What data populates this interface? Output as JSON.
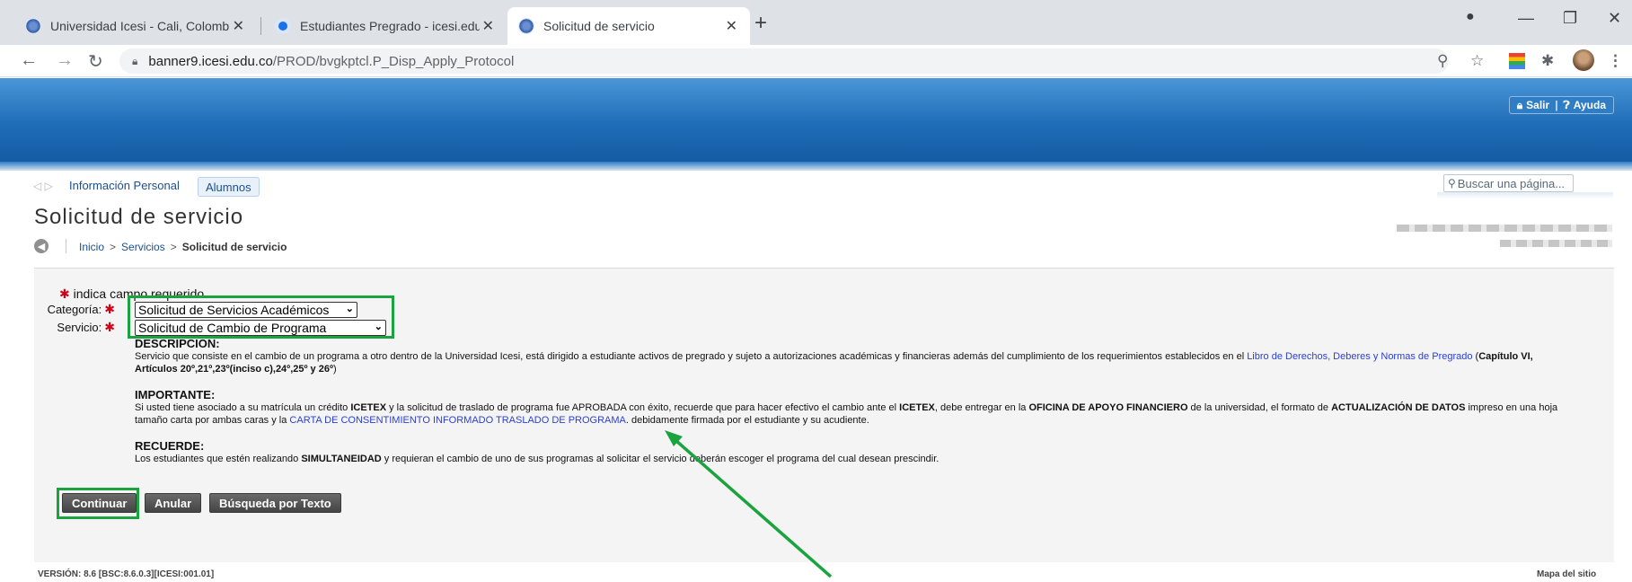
{
  "browser": {
    "tabs": [
      {
        "title": "Universidad Icesi - Cali, Colombia"
      },
      {
        "title": "Estudiantes Pregrado - icesi.edu.co"
      },
      {
        "title": "Solicitud de servicio"
      }
    ],
    "url_host": "banner9.icesi.edu.co",
    "url_path": "/PROD/bvgkptcl.P_Disp_Apply_Protocol"
  },
  "header": {
    "salir_label": "Salir",
    "ayuda_label": "Ayuda",
    "brand_color": "#1f6db8"
  },
  "nav": {
    "personal_label": "Información Personal",
    "alumnos_label": "Alumnos",
    "search_placeholder": "Buscar una página..."
  },
  "page": {
    "title": "Solicitud de servicio",
    "breadcrumb": {
      "inicio": "Inicio",
      "servicios": "Servicios",
      "current": "Solicitud de servicio"
    }
  },
  "form": {
    "required_note": "indica campo requerido",
    "categoria_label": "Categoría:",
    "categoria_value": "Solicitud de Servicios Académicos",
    "servicio_label": "Servicio:",
    "servicio_value": "Solicitud de Cambio de Programa"
  },
  "description": {
    "heading": "DESCRIPCION:",
    "text_1": "Servicio que consiste en el cambio de un programa a otro dentro de la Universidad Icesi, está dirigido a estudiante activos de pregrado y sujeto a autorizaciones académicas y financieras además del cumplimiento de los requerimientos establecidos en el ",
    "link": "Libro de Derechos, Deberes y Normas de Pregrado",
    "text_2": " (",
    "bold": "Capítulo VI, Artículos 20º,21º,23º(inciso c),24º,25º y 26º",
    "text_3": ")"
  },
  "importante": {
    "heading": "IMPORTANTE:",
    "t1": "Si usted tiene asociado a su matrícula un crédito ",
    "b1": "ICETEX",
    "t2": " y la solicitud de traslado de programa fue APROBADA con éxito, recuerde que para hacer efectivo el cambio ante el ",
    "b2": "ICETEX",
    "t3": ", debe entregar en la ",
    "b3": "OFICINA DE APOYO FINANCIERO",
    "t4": " de la universidad, el formato de ",
    "b4": "ACTUALIZACIÓN DE DATOS",
    "t5": " impreso en una hoja tamaño carta por ambas caras y la ",
    "link": "CARTA DE CONSENTIMIENTO INFORMADO TRASLADO DE PROGRAMA",
    "t6": ". debidamente firmada por el estudiante y su acudiente."
  },
  "recuerde": {
    "heading": "RECUERDE:",
    "t1": "Los estudiantes que estén realizando ",
    "b1": "SIMULTANEIDAD",
    "t2": " y requieran el cambio de uno de sus programas al solicitar el servicio deberán escoger el programa del cual desean prescindir."
  },
  "buttons": {
    "continuar": "Continuar",
    "anular": "Anular",
    "busqueda": "Búsqueda por Texto"
  },
  "footer": {
    "version": "VERSIÓN: 8.6 [BSC:8.6.0.3][ICESI:001.01]",
    "sitemap": "Mapa del sitio"
  },
  "annotation_color": "#1aa33e"
}
